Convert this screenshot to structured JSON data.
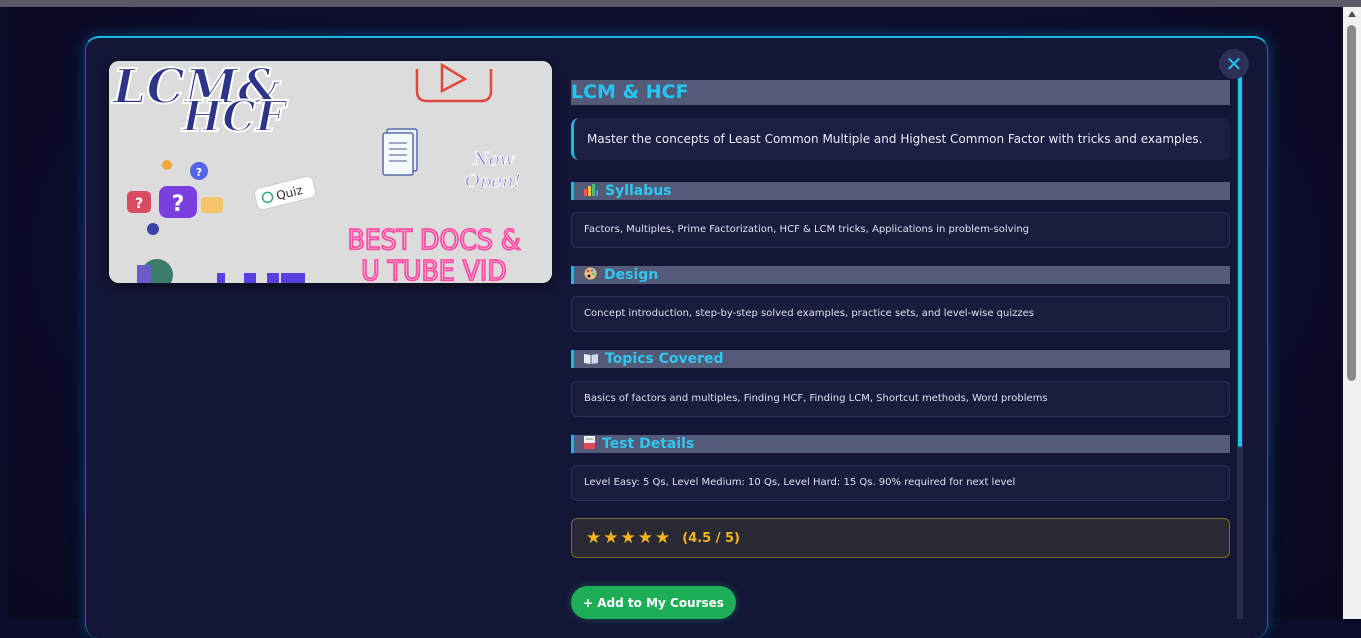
{
  "course": {
    "title": "LCM & HCF",
    "description": "Master the concepts of Least Common Multiple and Highest Common Factor with tricks and examples.",
    "close_icon": "close-icon"
  },
  "hero": {
    "title_line1": "LCM&",
    "title_line2": "HCF",
    "quiz_label": "Quiz",
    "open_line1": "Now",
    "open_line2": "Open!",
    "neon_line1": "BEST DOCS &",
    "neon_line2": "U TUBE VID"
  },
  "sections": [
    {
      "icon": "bar-chart-icon",
      "heading": "Syllabus",
      "content": "Factors, Multiples, Prime Factorization, HCF & LCM tricks, Applications in problem-solving"
    },
    {
      "icon": "palette-icon",
      "heading": "Design",
      "content": "Concept introduction, step-by-step solved examples, practice sets, and level-wise quizzes"
    },
    {
      "icon": "book-icon",
      "heading": "Topics Covered",
      "content": "Basics of factors and multiples, Finding HCF, Finding LCM, Shortcut methods, Word problems"
    },
    {
      "icon": "document-icon",
      "heading": "Test Details",
      "content": "Level Easy: 5 Qs, Level Medium: 10 Qs, Level Hard: 15 Qs. 90% required for next level"
    }
  ],
  "rating": {
    "stars": 5,
    "text": "(4.5 / 5)",
    "color": "#f4b51c"
  },
  "actions": {
    "add_label": "+ Add to My Courses"
  },
  "colors": {
    "accent": "#19b8e6",
    "add_button": "#1fae58",
    "background": "#141638"
  }
}
